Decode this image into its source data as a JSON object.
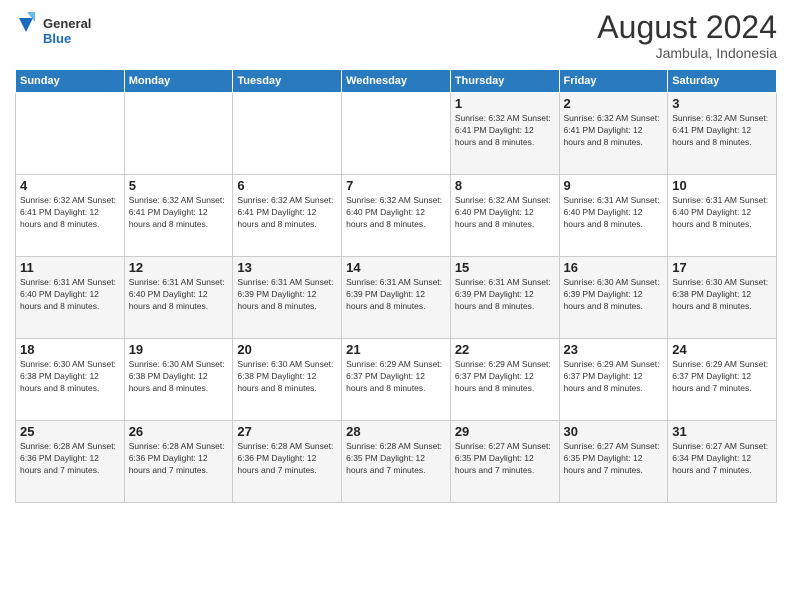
{
  "logo": {
    "line1": "General",
    "line2": "Blue"
  },
  "title": "August 2024",
  "location": "Jambula, Indonesia",
  "days_of_week": [
    "Sunday",
    "Monday",
    "Tuesday",
    "Wednesday",
    "Thursday",
    "Friday",
    "Saturday"
  ],
  "weeks": [
    [
      {
        "day": "",
        "info": ""
      },
      {
        "day": "",
        "info": ""
      },
      {
        "day": "",
        "info": ""
      },
      {
        "day": "",
        "info": ""
      },
      {
        "day": "1",
        "info": "Sunrise: 6:32 AM\nSunset: 6:41 PM\nDaylight: 12 hours and 8 minutes."
      },
      {
        "day": "2",
        "info": "Sunrise: 6:32 AM\nSunset: 6:41 PM\nDaylight: 12 hours and 8 minutes."
      },
      {
        "day": "3",
        "info": "Sunrise: 6:32 AM\nSunset: 6:41 PM\nDaylight: 12 hours and 8 minutes."
      }
    ],
    [
      {
        "day": "4",
        "info": "Sunrise: 6:32 AM\nSunset: 6:41 PM\nDaylight: 12 hours and 8 minutes."
      },
      {
        "day": "5",
        "info": "Sunrise: 6:32 AM\nSunset: 6:41 PM\nDaylight: 12 hours and 8 minutes."
      },
      {
        "day": "6",
        "info": "Sunrise: 6:32 AM\nSunset: 6:41 PM\nDaylight: 12 hours and 8 minutes."
      },
      {
        "day": "7",
        "info": "Sunrise: 6:32 AM\nSunset: 6:40 PM\nDaylight: 12 hours and 8 minutes."
      },
      {
        "day": "8",
        "info": "Sunrise: 6:32 AM\nSunset: 6:40 PM\nDaylight: 12 hours and 8 minutes."
      },
      {
        "day": "9",
        "info": "Sunrise: 6:31 AM\nSunset: 6:40 PM\nDaylight: 12 hours and 8 minutes."
      },
      {
        "day": "10",
        "info": "Sunrise: 6:31 AM\nSunset: 6:40 PM\nDaylight: 12 hours and 8 minutes."
      }
    ],
    [
      {
        "day": "11",
        "info": "Sunrise: 6:31 AM\nSunset: 6:40 PM\nDaylight: 12 hours and 8 minutes."
      },
      {
        "day": "12",
        "info": "Sunrise: 6:31 AM\nSunset: 6:40 PM\nDaylight: 12 hours and 8 minutes."
      },
      {
        "day": "13",
        "info": "Sunrise: 6:31 AM\nSunset: 6:39 PM\nDaylight: 12 hours and 8 minutes."
      },
      {
        "day": "14",
        "info": "Sunrise: 6:31 AM\nSunset: 6:39 PM\nDaylight: 12 hours and 8 minutes."
      },
      {
        "day": "15",
        "info": "Sunrise: 6:31 AM\nSunset: 6:39 PM\nDaylight: 12 hours and 8 minutes."
      },
      {
        "day": "16",
        "info": "Sunrise: 6:30 AM\nSunset: 6:39 PM\nDaylight: 12 hours and 8 minutes."
      },
      {
        "day": "17",
        "info": "Sunrise: 6:30 AM\nSunset: 6:38 PM\nDaylight: 12 hours and 8 minutes."
      }
    ],
    [
      {
        "day": "18",
        "info": "Sunrise: 6:30 AM\nSunset: 6:38 PM\nDaylight: 12 hours and 8 minutes."
      },
      {
        "day": "19",
        "info": "Sunrise: 6:30 AM\nSunset: 6:38 PM\nDaylight: 12 hours and 8 minutes."
      },
      {
        "day": "20",
        "info": "Sunrise: 6:30 AM\nSunset: 6:38 PM\nDaylight: 12 hours and 8 minutes."
      },
      {
        "day": "21",
        "info": "Sunrise: 6:29 AM\nSunset: 6:37 PM\nDaylight: 12 hours and 8 minutes."
      },
      {
        "day": "22",
        "info": "Sunrise: 6:29 AM\nSunset: 6:37 PM\nDaylight: 12 hours and 8 minutes."
      },
      {
        "day": "23",
        "info": "Sunrise: 6:29 AM\nSunset: 6:37 PM\nDaylight: 12 hours and 8 minutes."
      },
      {
        "day": "24",
        "info": "Sunrise: 6:29 AM\nSunset: 6:37 PM\nDaylight: 12 hours and 7 minutes."
      }
    ],
    [
      {
        "day": "25",
        "info": "Sunrise: 6:28 AM\nSunset: 6:36 PM\nDaylight: 12 hours and 7 minutes."
      },
      {
        "day": "26",
        "info": "Sunrise: 6:28 AM\nSunset: 6:36 PM\nDaylight: 12 hours and 7 minutes."
      },
      {
        "day": "27",
        "info": "Sunrise: 6:28 AM\nSunset: 6:36 PM\nDaylight: 12 hours and 7 minutes."
      },
      {
        "day": "28",
        "info": "Sunrise: 6:28 AM\nSunset: 6:35 PM\nDaylight: 12 hours and 7 minutes."
      },
      {
        "day": "29",
        "info": "Sunrise: 6:27 AM\nSunset: 6:35 PM\nDaylight: 12 hours and 7 minutes."
      },
      {
        "day": "30",
        "info": "Sunrise: 6:27 AM\nSunset: 6:35 PM\nDaylight: 12 hours and 7 minutes."
      },
      {
        "day": "31",
        "info": "Sunrise: 6:27 AM\nSunset: 6:34 PM\nDaylight: 12 hours and 7 minutes."
      }
    ]
  ]
}
